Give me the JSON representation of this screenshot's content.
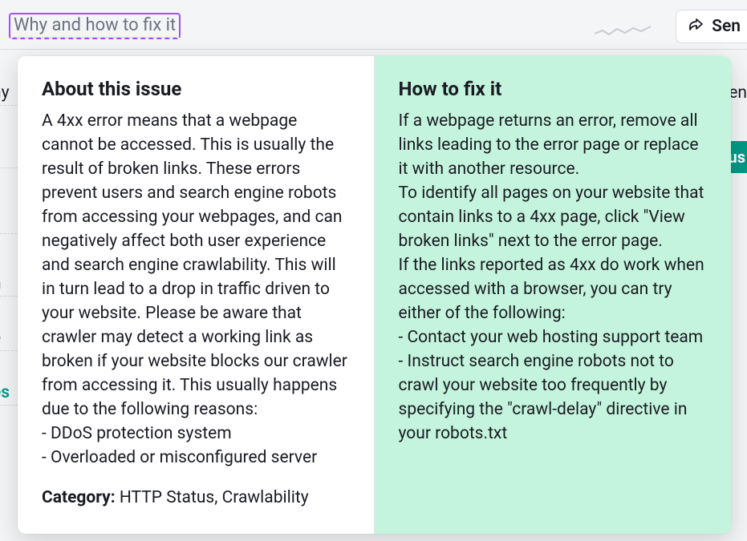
{
  "top": {
    "link_label": "Why and how to fix it",
    "send_label": "Sen"
  },
  "bg_left_items": [
    "hy",
    "y",
    "l",
    "n",
    "e",
    "es"
  ],
  "bg_right_items": [
    "en",
    "us"
  ],
  "tooltip": {
    "about": {
      "heading": "About this issue",
      "body": "A 4xx error means that a webpage cannot be accessed. This is usually the result of broken links. These errors prevent users and search engine robots from accessing your webpages, and can negatively affect both user experience and search engine crawlability. This will in turn lead to a drop in traffic driven to your website. Please be aware that crawler may detect a working link as broken if your website blocks our crawler from accessing it. This usually happens due to the following reasons:\n- DDoS protection system\n- Overloaded or misconfigured server",
      "category_label": "Category:",
      "category_value": " HTTP Status, Crawlability"
    },
    "fix": {
      "heading": "How to fix it",
      "body": "If a webpage returns an error, remove all links leading to the error page or replace it with another resource.\nTo identify all pages on your website that contain links to a 4xx page, click \"View broken links\" next to the error page.\nIf the links reported as 4xx do work when accessed with a browser, you can try either of the following:\n- Contact your web hosting support team\n- Instruct search engine robots not to crawl your website too frequently by specifying the \"crawl-delay\" directive in your robots.txt"
    }
  }
}
